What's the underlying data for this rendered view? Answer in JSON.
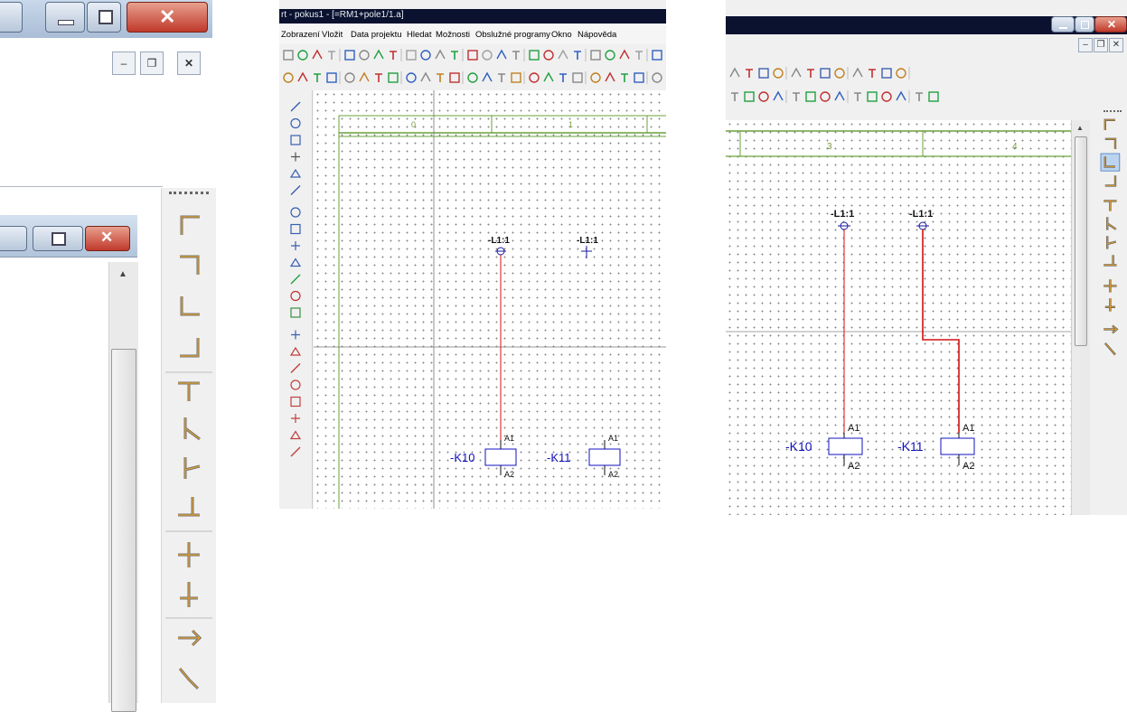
{
  "left_panel": {
    "vtb_icons": [
      "elbow-down-right",
      "elbow-down-left",
      "elbow-up-right",
      "elbow-up-left",
      "tee-down",
      "tee-branch-right",
      "tee-branch-left",
      "tee-branch-up",
      "junction-down",
      "junction-up",
      "arrow-right",
      "diagonal"
    ]
  },
  "middle_panel": {
    "title": "rt - pokus1 - [=RM1+pole1/1.a]",
    "menu": [
      "Zobrazení",
      "Vložit",
      "Data projektu",
      "Hledat",
      "Možnosti",
      "Obslužné programy",
      "Okno",
      "Nápověda"
    ],
    "columns": [
      "0",
      "1"
    ],
    "terminal_labels": [
      "-L1:1",
      "-L1:1"
    ],
    "relays": [
      {
        "name": "-K10",
        "a1": "A1",
        "a2": "A2"
      },
      {
        "name": "-K11",
        "a1": "A1",
        "a2": "A2"
      }
    ]
  },
  "right_panel": {
    "columns": [
      "3",
      "4"
    ],
    "terminal_labels": [
      "-L1:1",
      "-L1:1"
    ],
    "relays": [
      {
        "name": "-K10",
        "a1": "A1",
        "a2": "A2"
      },
      {
        "name": "-K11",
        "a1": "A1",
        "a2": "A2"
      }
    ]
  },
  "colors": {
    "wire": "#d11010",
    "relay": "#1010c0",
    "frame": "#6aa03a",
    "titlebar": "#0a1230"
  }
}
